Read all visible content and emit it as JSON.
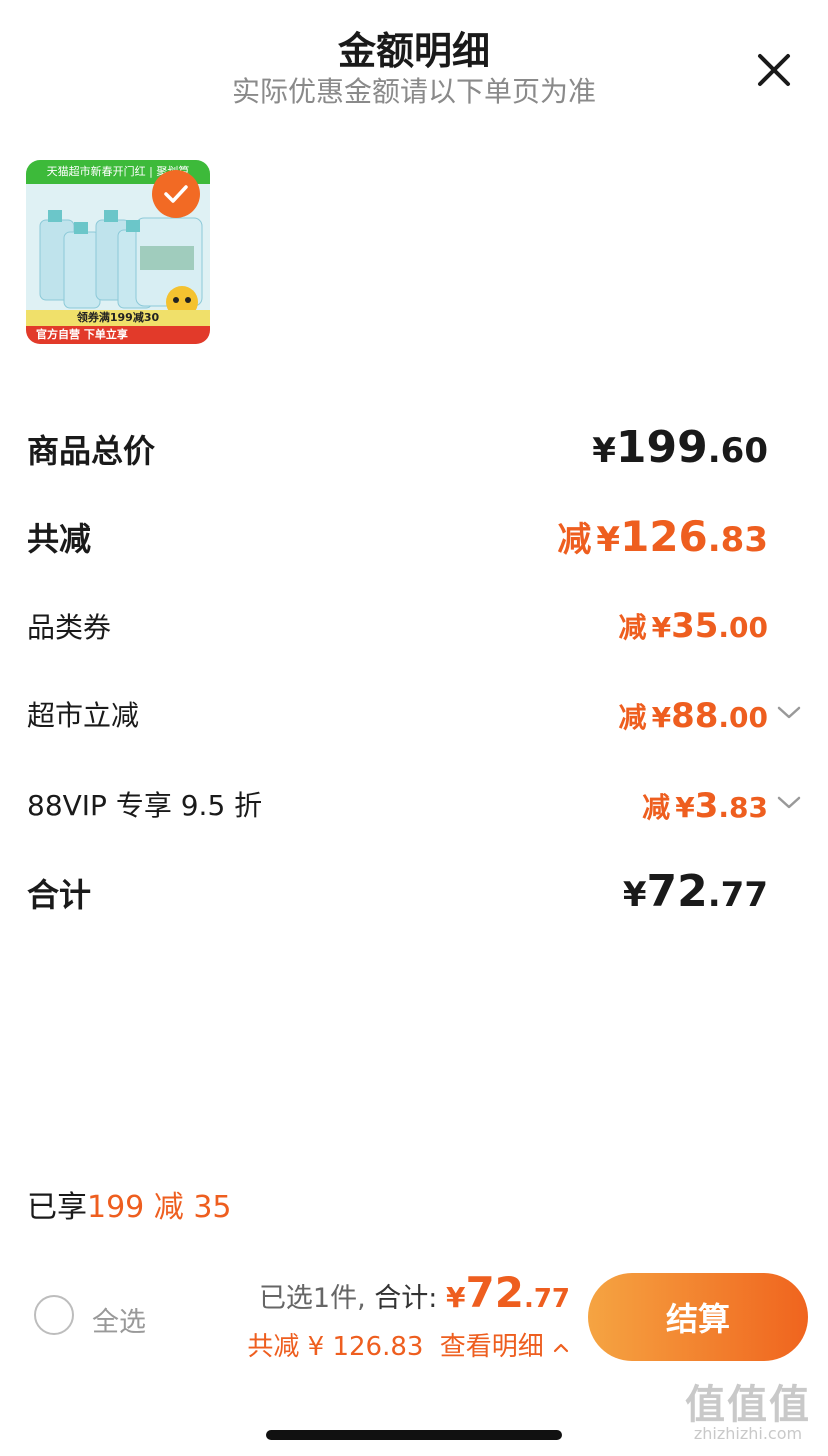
{
  "header": {
    "title": "金额明细",
    "subtitle": "实际优惠金额请以下单页为准"
  },
  "product": {
    "top_banner": "天猫超市新春开门红 | 聚划算",
    "coupon_text": "领券满199减30",
    "bottom_text": "官方自营 下单立享",
    "selected": true
  },
  "rows": {
    "subtotal": {
      "label": "商品总价",
      "currency": "¥",
      "int": "199",
      "dec": ".60"
    },
    "total_discount": {
      "label": "共减",
      "prefix": "减",
      "currency": "¥",
      "int": "126",
      "dec": ".83"
    },
    "category_coupon": {
      "label": "品类券",
      "prefix": "减",
      "currency": "¥",
      "int": "35",
      "dec": ".00"
    },
    "supermarket_discount": {
      "label": "超市立减",
      "prefix": "减",
      "currency": "¥",
      "int": "88",
      "dec": ".00"
    },
    "vip_discount": {
      "label": "88VIP 专享 9.5 折",
      "prefix": "减",
      "currency": "¥",
      "int": "3",
      "dec": ".83"
    },
    "total": {
      "label": "合计",
      "currency": "¥",
      "int": "72",
      "dec": ".77"
    }
  },
  "promo": {
    "prefix": "已享",
    "highlight": "199 减 35"
  },
  "footer": {
    "select_all": "全选",
    "selected_count": "已选1件,",
    "total_label": "合计:",
    "currency": "¥",
    "total_int": "72",
    "total_dec": ".77",
    "savings_text": "共减 ¥ 126.83",
    "view_detail": "查看明细",
    "checkout_label": "结算"
  },
  "watermark": {
    "main": "值值值",
    "sub": "zhizhizhi.com"
  },
  "colors": {
    "accent": "#ee5e1f",
    "checkout_start": "#f5a442",
    "checkout_end": "#f0641e"
  }
}
